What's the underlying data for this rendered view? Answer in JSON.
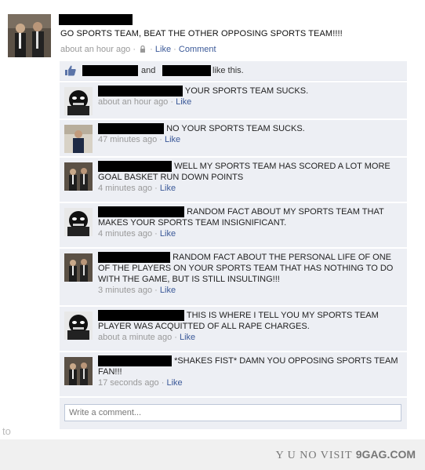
{
  "post": {
    "text": "GO SPORTS TEAM, BEAT THE OTHER OPPOSING SPORTS TEAM!!!!",
    "time": "about an hour ago",
    "sep1": "·",
    "like": "Like",
    "sep2": "·",
    "comment": "Comment"
  },
  "likes": {
    "and": "and",
    "tail": "like this."
  },
  "comments": [
    {
      "text": "YOUR SPORTS TEAM SUCKS.",
      "time": "about an hour ago",
      "like": "Like"
    },
    {
      "text": "NO YOUR SPORTS TEAM SUCKS.",
      "time": "47 minutes ago",
      "like": "Like"
    },
    {
      "text": "WELL MY SPORTS TEAM HAS SCORED A LOT MORE GOAL BASKET RUN DOWN POINTS",
      "time": "4 minutes ago",
      "like": "Like"
    },
    {
      "text": "RANDOM FACT ABOUT MY SPORTS TEAM THAT MAKES YOUR SPORTS TEAM INSIGNIFICANT.",
      "time": "4 minutes ago",
      "like": "Like"
    },
    {
      "text": "RANDOM FACT ABOUT THE PERSONAL LIFE OF ONE OF THE PLAYERS ON YOUR SPORTS TEAM THAT HAS NOTHING TO DO WITH THE GAME, BUT IS STILL INSULTING!!!",
      "time": "3 minutes ago",
      "like": "Like"
    },
    {
      "text": "THIS IS WHERE I TELL YOU MY SPORTS TEAM PLAYER WAS ACQUITTED OF ALL RAPE CHARGES.",
      "time": "about a minute ago",
      "like": "Like"
    },
    {
      "text": "*SHAKES FIST* DAMN YOU OPPOSING SPORTS TEAM FAN!!!",
      "time": "17 seconds ago",
      "like": "Like"
    }
  ],
  "write_comment": {
    "placeholder": "Write a comment..."
  },
  "side_text": "to",
  "footer": {
    "prefix": "Y U NO VISIT ",
    "brand": "9GAG.COM"
  },
  "colors": {
    "link": "#3b5998",
    "thread_bg": "#edeff4",
    "meta": "#999999"
  }
}
